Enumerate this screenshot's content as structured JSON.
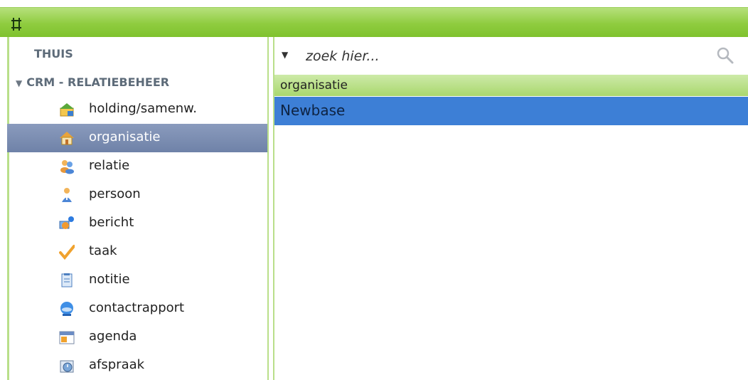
{
  "topbar": {
    "grip_icon": "move-grip-icon"
  },
  "sidebar": {
    "home_label": "THUIS",
    "crm_label": "CRM - RELATIEBEHEER",
    "items": [
      {
        "label": "holding/samenw.",
        "icon": "holding-house-icon"
      },
      {
        "label": "organisatie",
        "icon": "house-icon"
      },
      {
        "label": "relatie",
        "icon": "people-icon"
      },
      {
        "label": "persoon",
        "icon": "person-icon"
      },
      {
        "label": "bericht",
        "icon": "message-icon"
      },
      {
        "label": "taak",
        "icon": "checkmark-icon"
      },
      {
        "label": "notitie",
        "icon": "note-icon"
      },
      {
        "label": "contactrapport",
        "icon": "contact-report-icon"
      },
      {
        "label": "agenda",
        "icon": "calendar-icon"
      },
      {
        "label": "afspraak",
        "icon": "appointment-icon"
      }
    ],
    "selected": "organisatie"
  },
  "main": {
    "search": {
      "placeholder": "zoek hier..."
    },
    "column_header": "organisatie",
    "rows": [
      "Newbase"
    ]
  },
  "colors": {
    "accent_green": "#8fcc3f",
    "selection_blue": "#3d7fd6",
    "sidebar_selected": "#7a8db2"
  }
}
